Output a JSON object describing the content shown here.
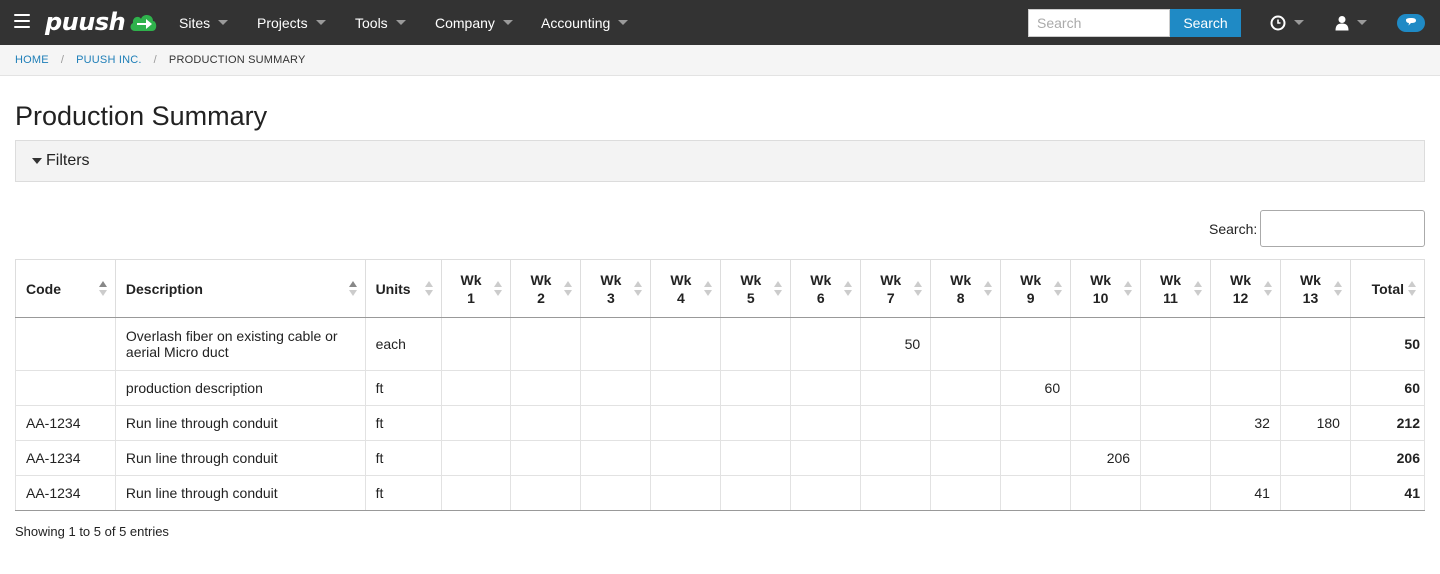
{
  "nav": {
    "brand": "puush",
    "items": [
      {
        "label": "Sites"
      },
      {
        "label": "Projects"
      },
      {
        "label": "Tools"
      },
      {
        "label": "Company"
      },
      {
        "label": "Accounting"
      }
    ],
    "search_placeholder": "Search",
    "search_button": "Search",
    "icons": [
      "clock-icon",
      "user-icon",
      "chat-icon"
    ],
    "accent_color": "#1f8ac5",
    "brand_icon_color": "#2fb24c"
  },
  "breadcrumb": {
    "items": [
      "HOME",
      "PUUSH INC."
    ],
    "current": "PRODUCTION SUMMARY"
  },
  "page": {
    "title": "Production Summary",
    "filters_label": "Filters",
    "table_search_label": "Search:",
    "info": "Showing 1 to 5 of 5 entries"
  },
  "table": {
    "columns": [
      {
        "line1": "Code",
        "line2": ""
      },
      {
        "line1": "Description",
        "line2": ""
      },
      {
        "line1": "Units",
        "line2": ""
      },
      {
        "line1": "Wk",
        "line2": "1"
      },
      {
        "line1": "Wk",
        "line2": "2"
      },
      {
        "line1": "Wk",
        "line2": "3"
      },
      {
        "line1": "Wk",
        "line2": "4"
      },
      {
        "line1": "Wk",
        "line2": "5"
      },
      {
        "line1": "Wk",
        "line2": "6"
      },
      {
        "line1": "Wk",
        "line2": "7"
      },
      {
        "line1": "Wk",
        "line2": "8"
      },
      {
        "line1": "Wk",
        "line2": "9"
      },
      {
        "line1": "Wk",
        "line2": "10"
      },
      {
        "line1": "Wk",
        "line2": "11"
      },
      {
        "line1": "Wk",
        "line2": "12"
      },
      {
        "line1": "Wk",
        "line2": "13"
      },
      {
        "line1": "Total",
        "line2": ""
      }
    ],
    "rows": [
      [
        "",
        "Overlash fiber on existing cable or aerial Micro duct",
        "each",
        "",
        "",
        "",
        "",
        "",
        "",
        "50",
        "",
        "",
        "",
        "",
        "",
        "",
        "50"
      ],
      [
        "",
        "production description",
        "ft",
        "",
        "",
        "",
        "",
        "",
        "",
        "",
        "",
        "60",
        "",
        "",
        "",
        "",
        "60"
      ],
      [
        "AA-1234",
        "Run line through conduit",
        "ft",
        "",
        "",
        "",
        "",
        "",
        "",
        "",
        "",
        "",
        "",
        "",
        "32",
        "180",
        "212"
      ],
      [
        "AA-1234",
        "Run line through conduit",
        "ft",
        "",
        "",
        "",
        "",
        "",
        "",
        "",
        "",
        "",
        "206",
        "",
        "",
        "",
        "206"
      ],
      [
        "AA-1234",
        "Run line through conduit",
        "ft",
        "",
        "",
        "",
        "",
        "",
        "",
        "",
        "",
        "",
        "",
        "",
        "41",
        "",
        "41"
      ]
    ]
  }
}
